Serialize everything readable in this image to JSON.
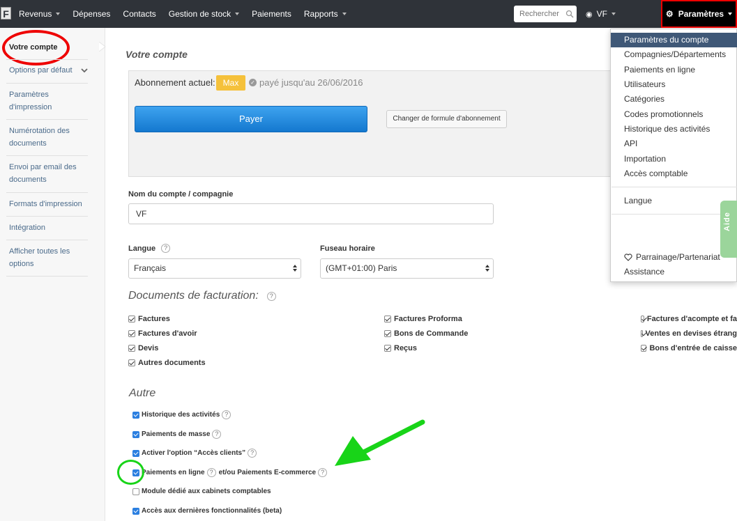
{
  "app": {
    "logo": "F"
  },
  "nav": {
    "items": [
      {
        "label": "Revenus",
        "caret": true
      },
      {
        "label": "Dépenses",
        "caret": false
      },
      {
        "label": "Contacts",
        "caret": false
      },
      {
        "label": "Gestion de stock",
        "caret": true
      },
      {
        "label": "Paiements",
        "caret": false
      },
      {
        "label": "Rapports",
        "caret": true
      }
    ],
    "search_placeholder": "Rechercher",
    "user_label": "VF",
    "settings_label": "Paramètres"
  },
  "sidebar": {
    "items": [
      {
        "label": "Votre compte",
        "active": true
      },
      {
        "label": "Options par défaut",
        "active": false
      },
      {
        "label": "Paramètres d'impression",
        "active": false
      },
      {
        "label": "Numérotation des documents",
        "active": false
      },
      {
        "label": "Envoi par email des documents",
        "active": false
      },
      {
        "label": "Formats d'impression",
        "active": false
      },
      {
        "label": "Intégration",
        "active": false
      },
      {
        "label": "Afficher toutes les options",
        "active": false
      }
    ]
  },
  "main": {
    "title": "Votre compte",
    "subscription": {
      "label": "Abonnement actuel:",
      "plan": "Max",
      "paid_until": "payé jusqu'au 26/06/2016",
      "pay_button": "Payer",
      "change_button": "Changer de formule d'abonnement"
    },
    "account_name_label": "Nom du compte / compagnie",
    "account_name_value": "VF",
    "language_label": "Langue",
    "language_value": "Français",
    "timezone_label": "Fuseau horaire",
    "timezone_value": "(GMT+01:00) Paris",
    "billing_docs_title": "Documents de facturation:",
    "billing_docs": [
      [
        "Factures",
        "Factures d'avoir",
        "Devis",
        "Autres documents"
      ],
      [
        "Factures Proforma",
        "Bons de Commande",
        "Reçus"
      ],
      [
        "Factures d'acompte et fa",
        "Ventes en devises étrang",
        "Bons d'entrée de caisse"
      ]
    ],
    "other_title": "Autre",
    "other_options": [
      {
        "label": "Historique des activités",
        "checked": true,
        "help": true
      },
      {
        "label": "Paiements de masse",
        "checked": true,
        "help": true
      },
      {
        "label": "Activer l'option “Accès clients”",
        "checked": true,
        "help": true
      },
      {
        "label": "Paiements en ligne",
        "checked": true,
        "help": true,
        "suffix": "et/ou Paiements E-commerce"
      },
      {
        "label": "Module dédié aux cabinets comptables",
        "checked": false,
        "help": false
      },
      {
        "label": "Accès aux dernières fonctionnalités (beta)",
        "checked": true,
        "help": false
      }
    ],
    "help_glyph": "?"
  },
  "dropdown": {
    "items": [
      "Paramètres du compte",
      "Compagnies/Départements",
      "Paiements en ligne",
      "Utilisateurs",
      "Catégories",
      "Codes promotionnels",
      "Historique des activités",
      "API",
      "Importation",
      "Accès comptable"
    ],
    "language": "Langue",
    "referral": "Parrainage/Partenariat",
    "support": "Assistance"
  },
  "help_tab": "Aide",
  "colors": {
    "navbar": "#2f3339",
    "accent_blue": "#2b7fe0",
    "badge": "#f5c13b",
    "annotation_red": "#e00000",
    "annotation_green": "#18d418"
  }
}
